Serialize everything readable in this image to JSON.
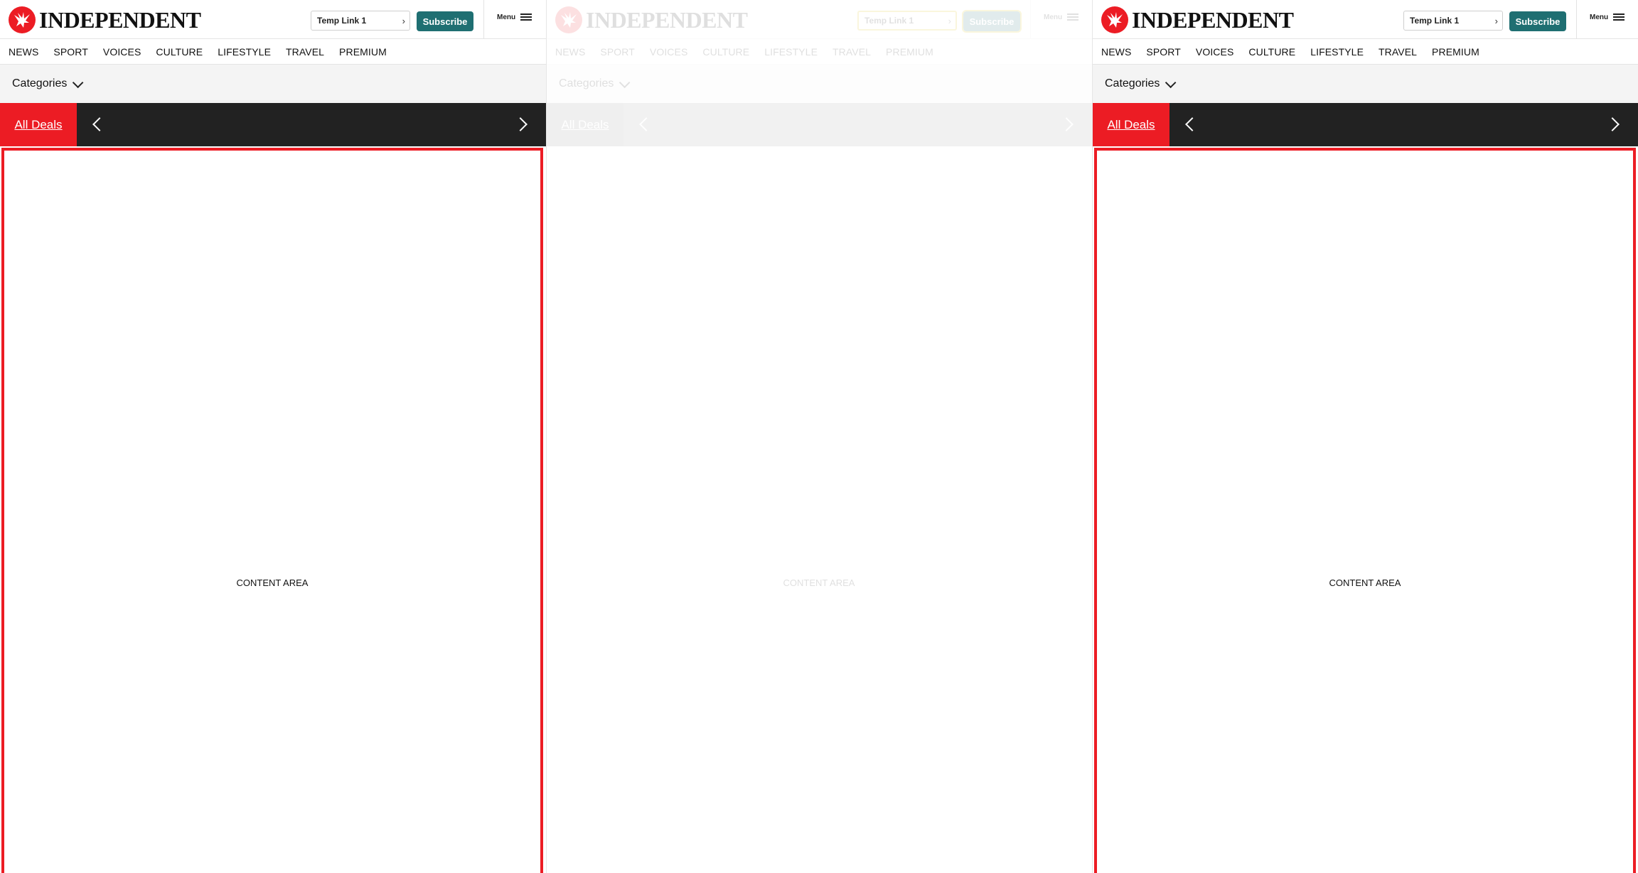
{
  "panels": [
    {
      "state": "normal"
    },
    {
      "state": "faded"
    },
    {
      "state": "normal"
    }
  ],
  "header": {
    "logo_text": "INDEPENDENT",
    "temp_link": "Temp Link 1",
    "subscribe_label": "Subscribe",
    "menu_label": "Menu"
  },
  "nav": [
    "NEWS",
    "SPORT",
    "VOICES",
    "CULTURE",
    "LIFESTYLE",
    "TRAVEL",
    "PREMIUM"
  ],
  "categories_label": "Categories",
  "deals": {
    "all_deals_label": "All Deals"
  },
  "content_label": "CONTENT AREA",
  "colors": {
    "brand_red": "#ec1c24",
    "subscribe_teal": "#1f6f72",
    "deals_bar": "#222222",
    "categories_bg": "#f4f4f4",
    "focus_outline": "#e0c000"
  },
  "icons": [
    "eagle-logo-icon",
    "chevron-right-icon",
    "hamburger-menu-icon",
    "chevron-down-icon",
    "chevron-left-icon"
  ]
}
